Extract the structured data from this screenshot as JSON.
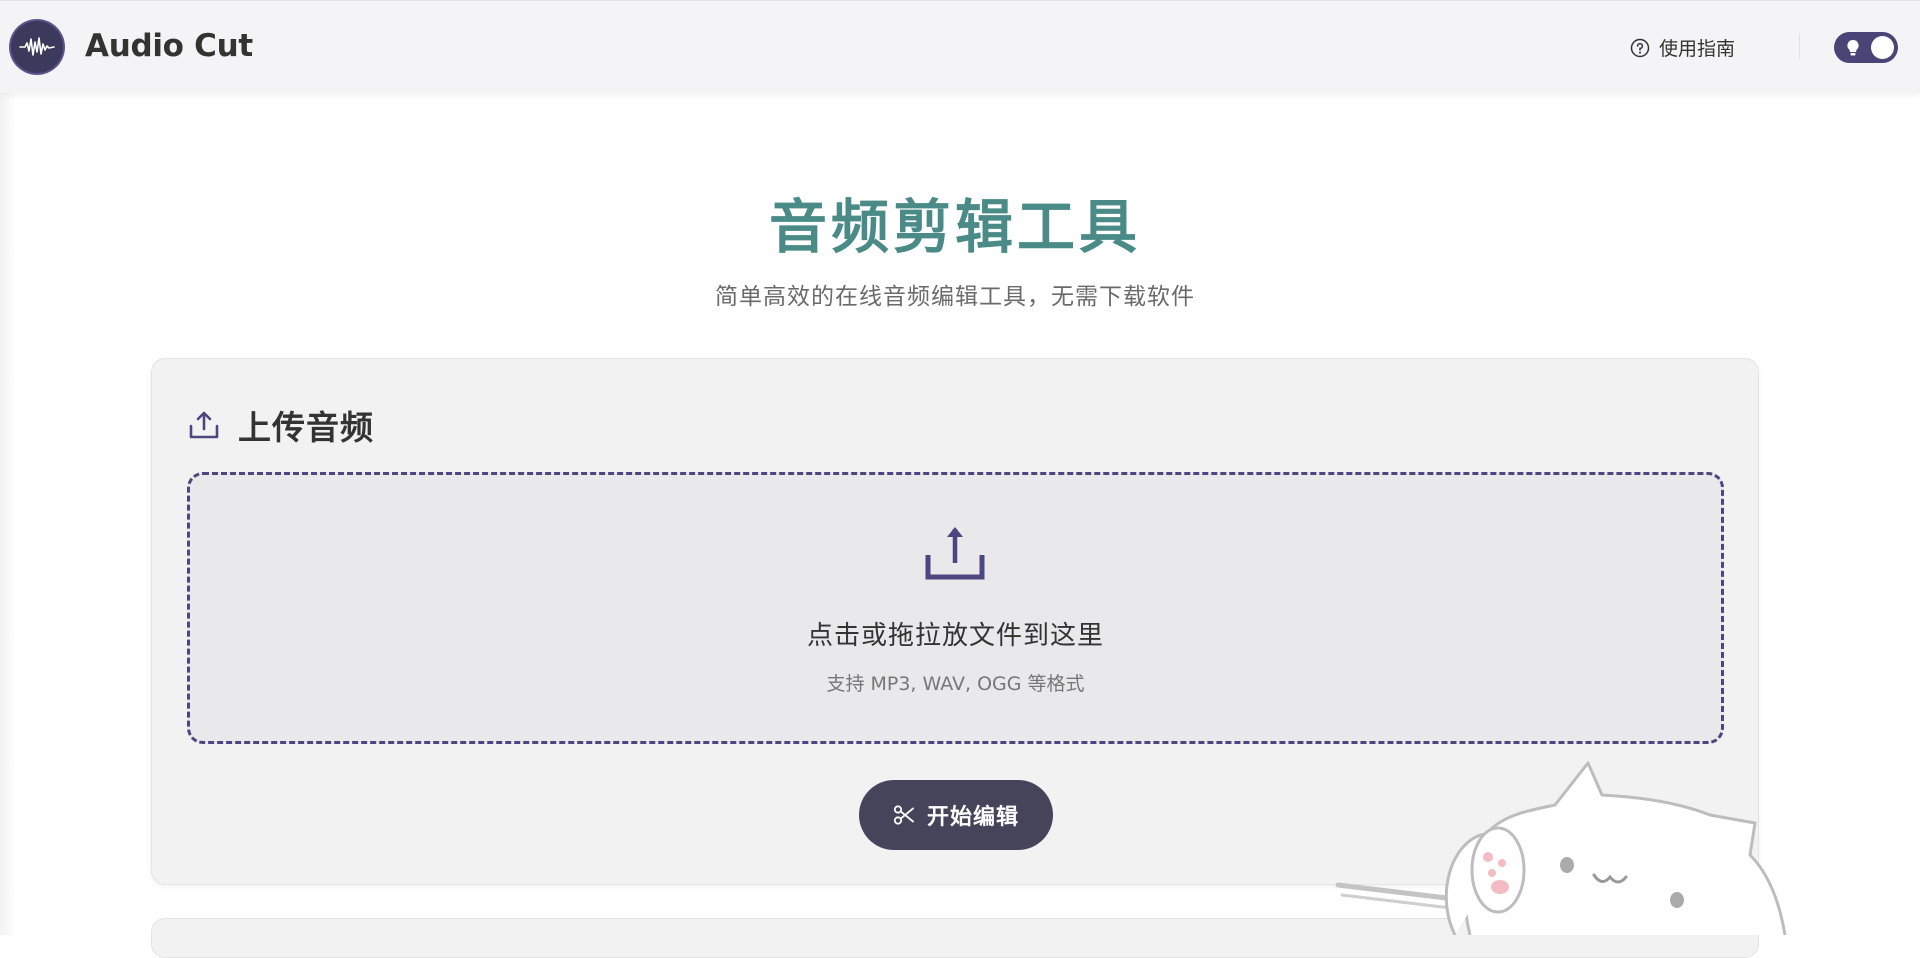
{
  "header": {
    "app_title": "Audio Cut",
    "guide_label": "使用指南",
    "logo_icon": "waveform-icon",
    "theme_toggle_icon": "lightbulb-icon"
  },
  "hero": {
    "title": "音频剪辑工具",
    "subtitle": "简单高效的在线音频编辑工具，无需下载软件"
  },
  "upload_card": {
    "title": "上传音频",
    "dropzone_text": "点击或拖拉放文件到这里",
    "dropzone_hint": "支持 MP3, WAV, OGG 等格式",
    "start_button_label": "开始编辑"
  },
  "colors": {
    "accent": "#4a4577",
    "title_teal": "#4a8a87",
    "button_dark": "#45445b"
  }
}
